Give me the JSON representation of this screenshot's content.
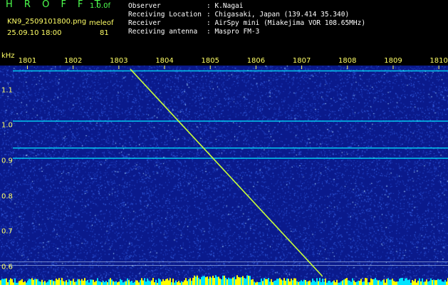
{
  "header": {
    "logo": "H R O F F T",
    "version": "1.0.0f",
    "filename": "KN9_2509101800.png",
    "program": "meleof",
    "datetime": "25.09.10 18:00",
    "count": "81"
  },
  "info": [
    {
      "label": "Observer",
      "value": ": K.Nagai"
    },
    {
      "label": "Receiving Location",
      "value": ": Chigasaki, Japan (139.414 35.340)"
    },
    {
      "label": "Receiver",
      "value": ": AirSpy mini (Miakejima VOR 108.65MHz)"
    },
    {
      "label": "Receiving antenna",
      "value": ": Maspro FM-3"
    }
  ],
  "chart_data": {
    "type": "heatmap",
    "ylabel": "kHz",
    "x_ticks": [
      "1801",
      "1802",
      "1803",
      "1804",
      "1805",
      "1806",
      "1807",
      "1808",
      "1809",
      "1810"
    ],
    "x_range": [
      1800.4,
      1810.2
    ],
    "y_ticks": [
      "1.1",
      "1.0",
      "0.9",
      "0.8",
      "0.7",
      "0.6"
    ],
    "y_range": [
      0.57,
      1.17
    ],
    "colors": {
      "background": "#0a1a8c",
      "noise": "#3a66e8",
      "signal": "#00e5ff",
      "meteor": "#c8ff3a",
      "floor": "#ffff00"
    },
    "carriers_khz": [
      1.155,
      1.013,
      0.937,
      0.908
    ],
    "meteor_trace": {
      "start": [
        1803.25,
        1.16
      ],
      "end": [
        1807.45,
        0.575
      ]
    }
  }
}
